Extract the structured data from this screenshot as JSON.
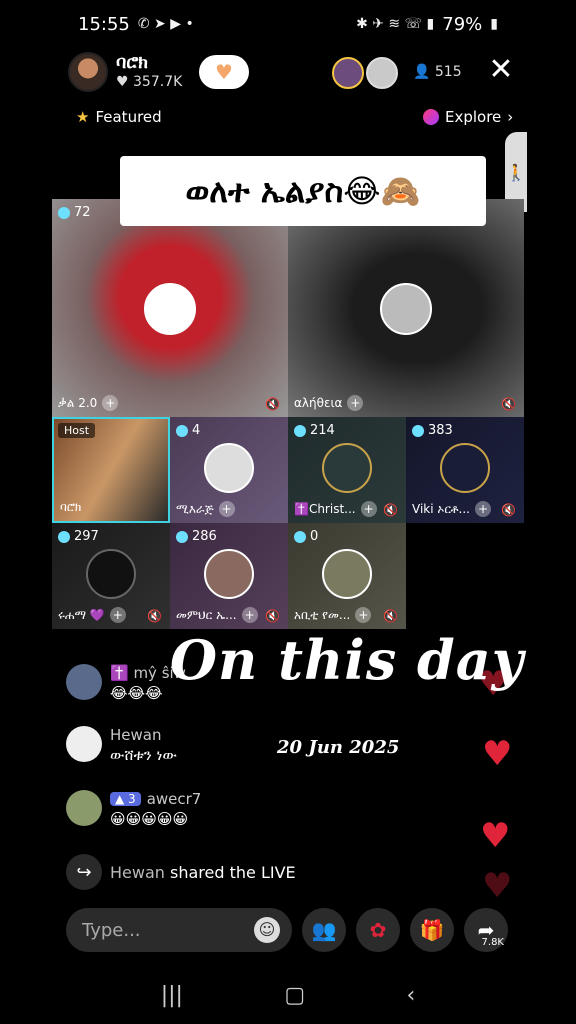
{
  "status": {
    "time": "15:55",
    "battery": "79%"
  },
  "host": {
    "name": "ባሮክ",
    "likes": "357.7K"
  },
  "viewers": {
    "count": "515"
  },
  "nav": {
    "featured": "Featured",
    "explore": "Explore"
  },
  "banner": {
    "title": "ወለተ ኤልያስ😂🙈"
  },
  "tiles": [
    {
      "count": "72",
      "name": "ቃል 2.0"
    },
    {
      "count": "",
      "name": "αλήθεια"
    },
    {
      "host_tag": "Host",
      "name": "ባሮክ"
    },
    {
      "count": "4",
      "name": "ሚእራጅ"
    },
    {
      "count": "214",
      "name": "✝️Christ..."
    },
    {
      "count": "383",
      "name": "Viki ኦርቶ..."
    },
    {
      "count": "297",
      "name": "ሩሐማ 💜"
    },
    {
      "count": "286",
      "name": "መምህር ኤ..."
    },
    {
      "count": "0",
      "name": "አቢቲ የመ..."
    }
  ],
  "overlay": {
    "headline": "On this day",
    "date": "20 Jun 2025"
  },
  "comments": [
    {
      "user": "✝️ mŷ ŝiŵ",
      "text": "😂😂😂"
    },
    {
      "user": "Hewan",
      "text": "ውሸቱን ነው"
    },
    {
      "level": "3",
      "user": "awecr7",
      "text": "😀😀😀😀😀"
    }
  ],
  "shared": {
    "user": "Hewan",
    "text": "shared the LIVE"
  },
  "input": {
    "placeholder": "Type..."
  },
  "share_count": "7.8K"
}
